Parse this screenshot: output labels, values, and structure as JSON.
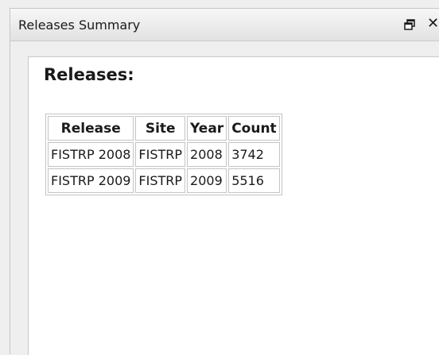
{
  "window": {
    "title": "Releases Summary",
    "restore_icon": "restore-window-icon",
    "close_label": "✕"
  },
  "content": {
    "heading": "Releases:",
    "table": {
      "headers": [
        "Release",
        "Site",
        "Year",
        "Count"
      ],
      "rows": [
        [
          "FISTRP 2008",
          "FISTRP",
          "2008",
          "3742"
        ],
        [
          "FISTRP 2009",
          "FISTRP",
          "2009",
          "5516"
        ]
      ]
    }
  }
}
